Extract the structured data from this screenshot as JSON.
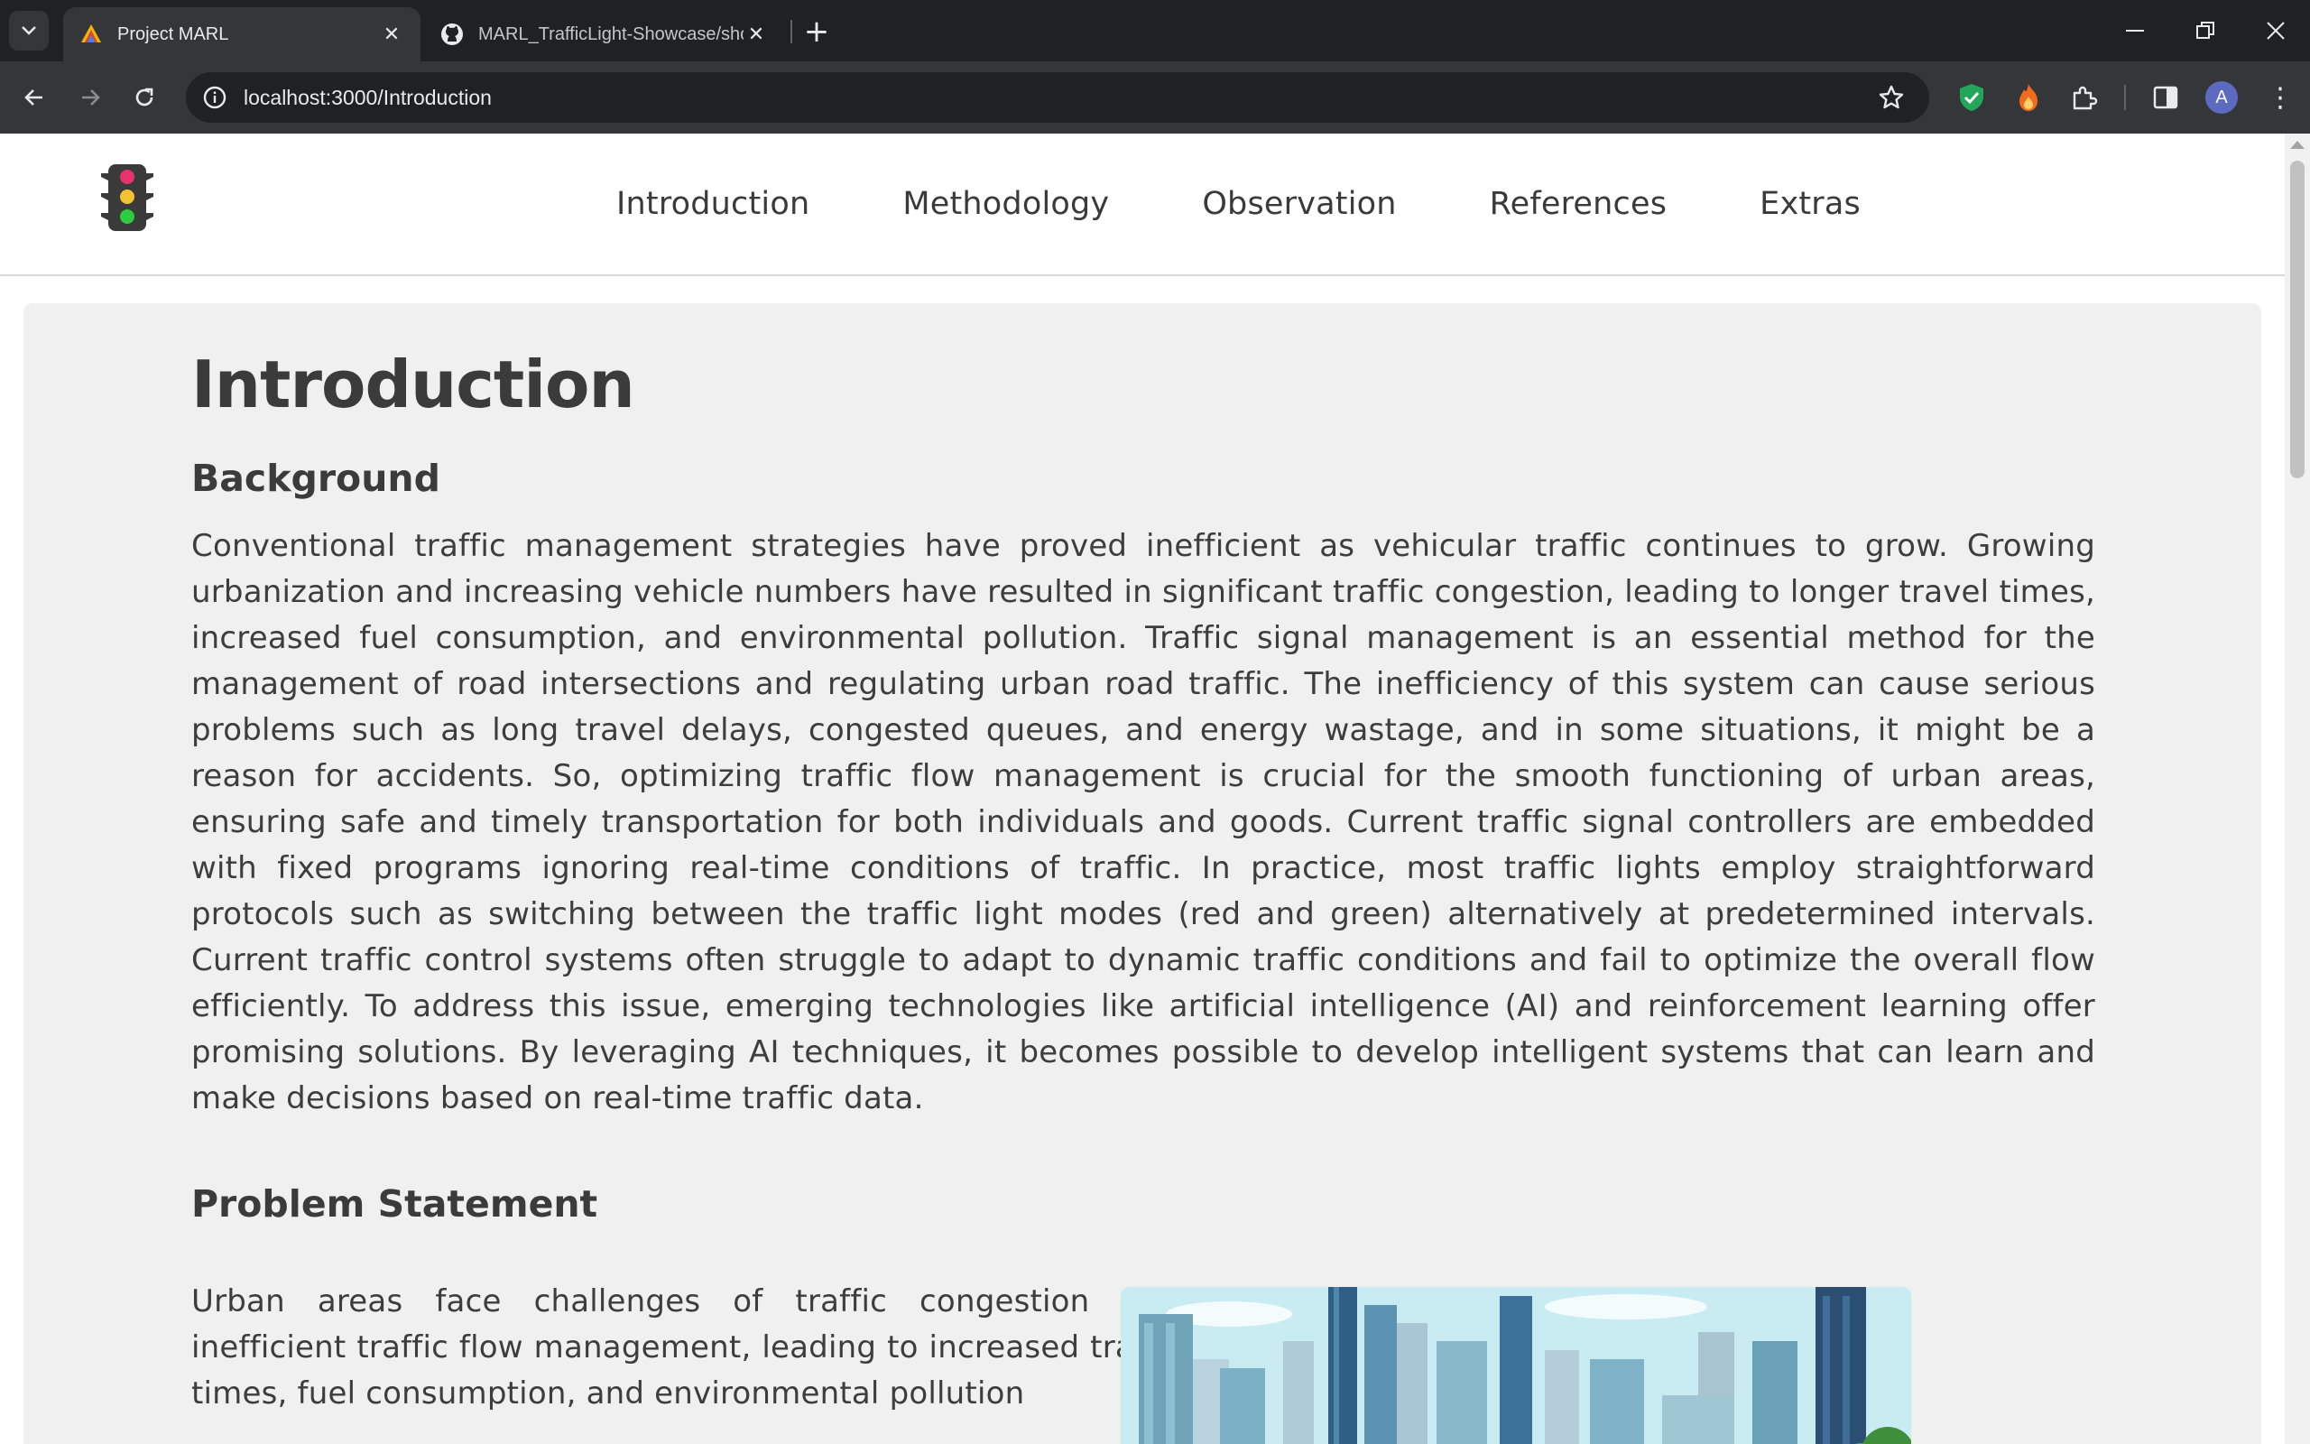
{
  "browser": {
    "tabs": [
      {
        "title": "Project MARL",
        "active": true
      },
      {
        "title": "MARL_TrafficLight-Showcase/show",
        "active": false
      }
    ],
    "address_bar": {
      "url": "localhost:3000/Introduction"
    },
    "profile_initial": "A"
  },
  "site": {
    "nav": [
      "Introduction",
      "Methodology",
      "Observation",
      "References",
      "Extras"
    ],
    "page_title": "Introduction",
    "sections": [
      {
        "heading": "Background",
        "text": "Conventional traffic management strategies have proved inefficient as vehicular traffic continues to grow. Growing urbanization and increasing vehicle numbers have resulted in significant traffic congestion, leading to longer travel times, increased fuel consumption, and environmental pollution. Traffic signal management is an essential method for the management of road intersections and regulating urban road traffic. The inefficiency of this system can cause serious problems such as long travel delays, congested queues, and energy wastage, and in some situations, it might be a reason for accidents. So, optimizing traffic flow management is crucial for the smooth functioning of urban areas, ensuring safe and timely transportation for both individuals and goods. Current traffic signal controllers are embedded with fixed programs ignoring real-time conditions of traffic. In practice, most traffic lights employ straightforward protocols such as switching between the traffic light modes (red and green) alternatively at predetermined intervals. Current traffic control systems often struggle to adapt to dynamic traffic conditions and fail to optimize the overall flow efficiently. To address this issue, emerging technologies like artificial intelligence (AI) and reinforcement learning offer promising solutions. By leveraging AI techniques, it becomes possible to develop intelligent systems that can learn and make decisions based on real-time traffic data."
      },
      {
        "heading": "Problem Statement",
        "text": "Urban areas face challenges of traffic congestion and inefficient traffic flow management, leading to increased travel times, fuel consumption, and environmental pollution"
      }
    ]
  },
  "colors": {
    "chrome_dark": "#202124",
    "chrome_tab": "#35363a",
    "card_bg": "#f0f0f0",
    "text": "#3d3d3d"
  }
}
